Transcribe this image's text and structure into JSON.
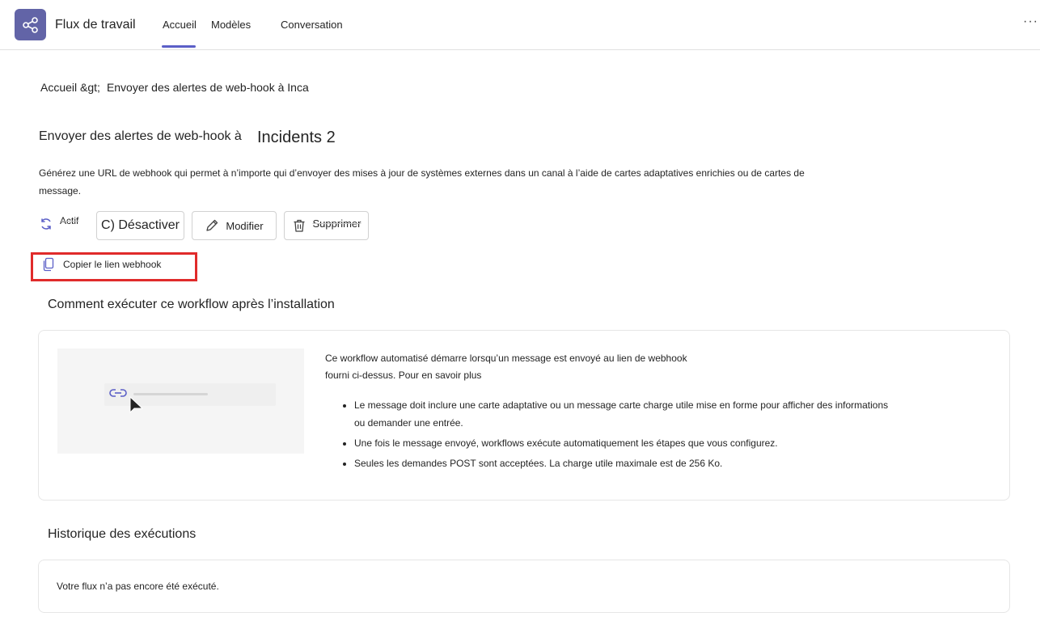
{
  "header": {
    "app_title": "Flux de travail",
    "tabs": [
      {
        "label": "Accueil",
        "active": true
      },
      {
        "label": "Modèles",
        "active": false
      },
      {
        "label": "Conversation",
        "active": false
      }
    ],
    "more_label": "···",
    "accent_color": "#6264a7"
  },
  "breadcrumb": {
    "home": "Accueil &gt;",
    "current": "Envoyer des alertes de web-hook à Inca"
  },
  "flow": {
    "title_prefix": "Envoyer des alertes de web-hook à",
    "title_channel": "Incidents 2",
    "description": "Générez une URL de webhook qui permet à n’importe qui d’envoyer des mises à jour de systèmes externes dans un canal à l’aide de cartes adaptatives enrichies ou de cartes de message."
  },
  "actions": {
    "status_label": "Actif",
    "deactivate_label": "C) Désactiver",
    "edit_label": "Modifier",
    "delete_label": "Supprimer",
    "copy_link_label": "Copier le lien webhook"
  },
  "how_to": {
    "title": "Comment exécuter ce workflow après l’installation",
    "intro_line1": "Ce workflow automatisé démarre lorsqu’un message est envoyé au lien de webhook",
    "intro_line2": "fourni ci-dessus. Pour en savoir plus",
    "bullets": [
      "Le message doit inclure une carte adaptative ou un message carte charge utile mise en forme pour afficher des informations ou demander une entrée.",
      "Une fois le message envoyé, workflows exécute automatiquement les étapes que vous configurez.",
      "Seules les demandes POST sont acceptées. La charge utile maximale est de 256 Ko."
    ]
  },
  "history": {
    "title": "Historique des exécutions",
    "empty_message": "Votre flux n’a pas encore été exécuté."
  }
}
